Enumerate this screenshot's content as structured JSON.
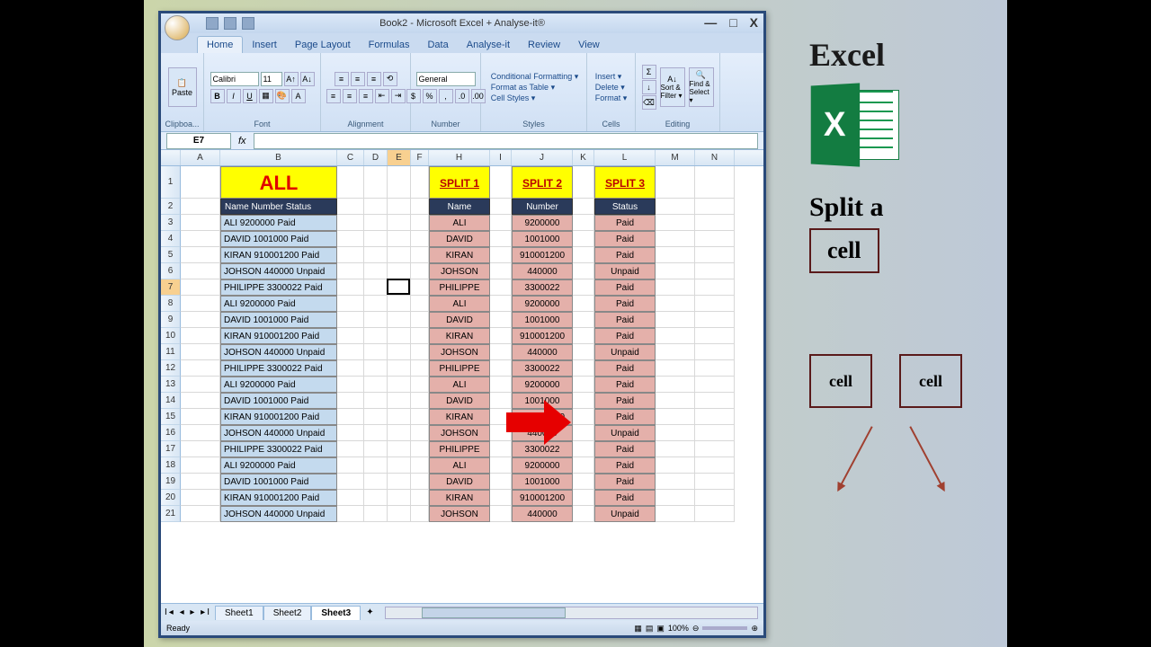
{
  "window": {
    "title": "Book2 - Microsoft Excel + Analyse-it®",
    "tabs": [
      "Home",
      "Insert",
      "Page Layout",
      "Formulas",
      "Data",
      "Analyse-it",
      "Review",
      "View"
    ],
    "ribbon_groups": {
      "clipboard": {
        "label": "Clipboa...",
        "paste": "Paste"
      },
      "font": {
        "label": "Font",
        "name": "Calibri",
        "size": "11"
      },
      "alignment": {
        "label": "Alignment"
      },
      "number": {
        "label": "Number",
        "format": "General"
      },
      "styles": {
        "label": "Styles",
        "cond": "Conditional Formatting ▾",
        "table": "Format as Table ▾",
        "cellstyles": "Cell Styles ▾"
      },
      "cells": {
        "label": "Cells",
        "insert": "Insert ▾",
        "delete": "Delete ▾",
        "format": "Format ▾"
      },
      "editing": {
        "label": "Editing",
        "sort": "Sort & Filter ▾",
        "find": "Find & Select ▾"
      }
    },
    "namebox": "E7",
    "sheets": [
      "Sheet1",
      "Sheet2",
      "Sheet3"
    ],
    "active_sheet": 2,
    "status": "Ready",
    "zoom": "100%"
  },
  "columns": [
    "A",
    "B",
    "C",
    "D",
    "E",
    "F",
    "H",
    "I",
    "J",
    "K",
    "L",
    "M",
    "N"
  ],
  "headers": {
    "all": "ALL",
    "split1": "SPLIT 1",
    "split2": "SPLIT 2",
    "split3": "SPLIT 3",
    "b2": "Name Number Status",
    "h2": "Name",
    "j2": "Number",
    "l2": "Status"
  },
  "rows": [
    {
      "b": "ALI 9200000  Paid",
      "h": "ALI",
      "j": "9200000",
      "l": "Paid"
    },
    {
      "b": "DAVID 1001000 Paid",
      "h": "DAVID",
      "j": "1001000",
      "l": "Paid"
    },
    {
      "b": "KIRAN 910001200 Paid",
      "h": "KIRAN",
      "j": "910001200",
      "l": "Paid"
    },
    {
      "b": "JOHSON 440000 Unpaid",
      "h": "JOHSON",
      "j": "440000",
      "l": "Unpaid"
    },
    {
      "b": "PHILIPPE 3300022 Paid",
      "h": "PHILIPPE",
      "j": "3300022",
      "l": "Paid"
    },
    {
      "b": "ALI 9200000  Paid",
      "h": "ALI",
      "j": "9200000",
      "l": "Paid"
    },
    {
      "b": "DAVID 1001000 Paid",
      "h": "DAVID",
      "j": "1001000",
      "l": "Paid"
    },
    {
      "b": "KIRAN 910001200 Paid",
      "h": "KIRAN",
      "j": "910001200",
      "l": "Paid"
    },
    {
      "b": "JOHSON 440000 Unpaid",
      "h": "JOHSON",
      "j": "440000",
      "l": "Unpaid"
    },
    {
      "b": "PHILIPPE 3300022 Paid",
      "h": "PHILIPPE",
      "j": "3300022",
      "l": "Paid"
    },
    {
      "b": "ALI 9200000  Paid",
      "h": "ALI",
      "j": "9200000",
      "l": "Paid"
    },
    {
      "b": "DAVID 1001000 Paid",
      "h": "DAVID",
      "j": "1001000",
      "l": "Paid"
    },
    {
      "b": "KIRAN 910001200 Paid",
      "h": "KIRAN",
      "j": "910001200",
      "l": "Paid"
    },
    {
      "b": "JOHSON 440000 Unpaid",
      "h": "JOHSON",
      "j": "440000",
      "l": "Unpaid"
    },
    {
      "b": "PHILIPPE 3300022 Paid",
      "h": "PHILIPPE",
      "j": "3300022",
      "l": "Paid"
    },
    {
      "b": "ALI 9200000  Paid",
      "h": "ALI",
      "j": "9200000",
      "l": "Paid"
    },
    {
      "b": "DAVID 1001000 Paid",
      "h": "DAVID",
      "j": "1001000",
      "l": "Paid"
    },
    {
      "b": "KIRAN 910001200 Paid",
      "h": "KIRAN",
      "j": "910001200",
      "l": "Paid"
    },
    {
      "b": "JOHSON 440000 Unpaid",
      "h": "JOHSON",
      "j": "440000",
      "l": "Unpaid"
    }
  ],
  "selected_row": 7,
  "side": {
    "title": "Excel",
    "text1": "Split a",
    "box1": "cell",
    "small1": "cell",
    "small2": "cell"
  }
}
